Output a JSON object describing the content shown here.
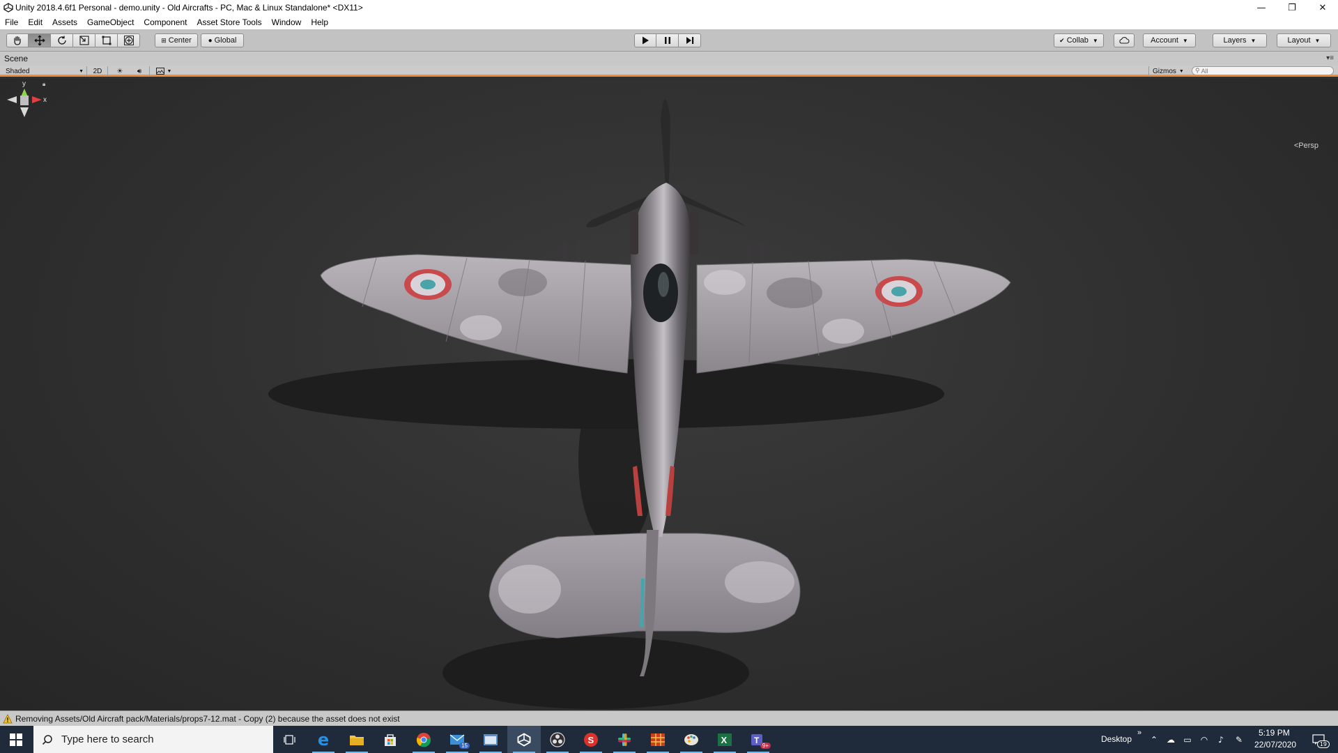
{
  "window": {
    "title": "Unity 2018.4.6f1 Personal - demo.unity - Old Aircrafts - PC, Mac & Linux Standalone* <DX11>",
    "controls": {
      "minimize": "—",
      "restore": "❐",
      "close": "✕"
    }
  },
  "menu": [
    "File",
    "Edit",
    "Assets",
    "GameObject",
    "Component",
    "Asset Store Tools",
    "Window",
    "Help"
  ],
  "toolbar": {
    "tools": [
      "hand-tool",
      "move-tool",
      "rotate-tool",
      "scale-tool",
      "rect-tool",
      "transform-tool"
    ],
    "active_tool": "move-tool",
    "pivot_label": "Center",
    "space_label": "Global",
    "collab_label": "Collab",
    "account_label": "Account",
    "layers_label": "Layers",
    "layout_label": "Layout"
  },
  "scene": {
    "tab_label": "Scene",
    "shading_mode": "Shaded",
    "mode_2d": "2D",
    "gizmos_label": "Gizmos",
    "search_placeholder": "All",
    "persp_label": "Persp",
    "axis_labels": {
      "y": "y",
      "x": "x"
    }
  },
  "console": {
    "message": "Removing Assets/Old Aircraft pack/Materials/props7-12.mat - Copy (2) because the asset does not exist"
  },
  "taskbar": {
    "search_placeholder": "Type here to search",
    "apps": [
      "task-view",
      "edge",
      "file-explorer",
      "store",
      "chrome",
      "mail",
      "app-window",
      "unity",
      "obs",
      "app-s",
      "slack",
      "app-grid",
      "paint",
      "excel",
      "teams"
    ],
    "mail_badge": "15",
    "teams_badge": "9+",
    "desktop_label": "Desktop",
    "time": "5:19 PM",
    "date": "22/07/2020",
    "notification_count": "19"
  },
  "colors": {
    "accent_orange": "#f08a34",
    "titlebar": "#ffffff",
    "toolbar": "#c2c2c2",
    "viewport": "#2f2f2f",
    "taskbar": "#1f2a3a"
  }
}
